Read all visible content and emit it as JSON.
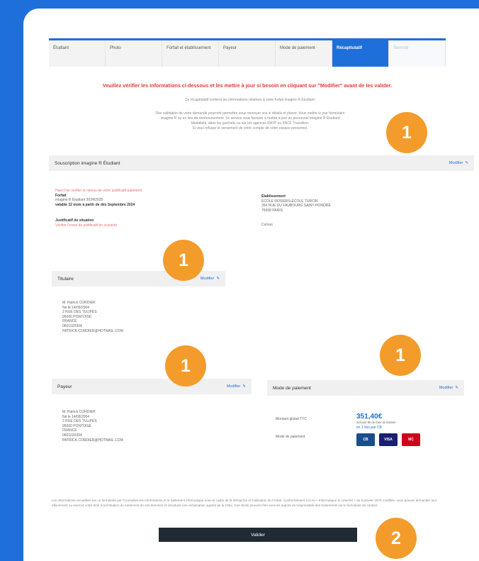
{
  "stepper": {
    "steps": [
      "Étudiant",
      "Photo",
      "Forfait et établissement",
      "Payeur",
      "Mode de paiement",
      "Récapitulatif",
      "Terminé"
    ]
  },
  "warning": "Veuillez vérifier les informations ci-dessous et les mettre à jour si besoin en cliquant sur \"Modifier\" avant de les valider.",
  "intro": {
    "line1": "Ce récapitulatif contient les informations relatives à votre forfait imagine R Étudiant.",
    "lines": [
      "Des validation de votre demande pourront permettre vous renvoyer vos si détails et placer. Vous mettre le jour formulaire",
      "imagine R ou en lieu de remboursement. Le service vous facturer à mettre à jour au personnel imagine R Étudiant",
      "Modalités, dans les guichets ou sur les agences RATP ou SNCF Transilien.",
      "Si vous refusez le versement de votre compte de votre espace personnel."
    ]
  },
  "subscription": {
    "title": "Souscription imagine R Étudiant",
    "modify": "Modifier",
    "note": "Hasn't be verifier le niveau de votre justificatif paiement",
    "forfait_label": "Forfait",
    "forfait_value": "imagine R Étudiant 2024/2025",
    "forfait_valid": "valable 12 mois à partir de dès Septembre 2024",
    "justif_label": "Justificatif de situation",
    "justif_value": "Vérifier l'envoi du justificatif de scolarité",
    "etab_label": "Établissement",
    "etab_lines": [
      "ECOLE ROSIERS-ECOLE TURCIN",
      "354 RUE DU FAUBOURG SAINT-HONORE",
      "75008 PARIS"
    ],
    "etab_extra": "Cursus"
  },
  "titulaire": {
    "title": "Titulaire",
    "modify": "Modifier",
    "lines": [
      "M. Patrick CORDIER",
      "Né le 14/09/2004",
      "2 RUE DES TULIPES",
      "95000 PONTOISE",
      "FRANCE",
      "0601020304",
      "PATRICK.CORDIER@HOTMAIL.COM"
    ]
  },
  "payeur": {
    "title": "Payeur",
    "modify": "Modifier",
    "lines": [
      "M. Patrick CORDIER",
      "Né le 14/09/2004",
      "2 RUE DES TULIPES",
      "95000 PONTOISE",
      "FRANCE",
      "0601020304",
      "PATRICK.CORDIER@HOTMAIL.COM"
    ]
  },
  "mode_paiement": {
    "title": "Mode de paiement",
    "modify": "Modifier",
    "montant_label": "Montant global TTC",
    "montant_value": "351,40€",
    "montant_note": "incluant 8€ de frais de dossier",
    "mode_label": "Mode de paiement",
    "mode_value": "en 1 fois par CB",
    "cards": [
      "CB",
      "VISA",
      "MC"
    ]
  },
  "legal": "Les informations recueillies sur ce formulaire par l'Consultez-les Informations et le traitement informatique sous le cadre de la démarche et l'utilisation du Forfait. Conformément à la loi « Informatique et Libertés » du 6 janvier 1978 modifiée, vous pouvez demander leur effacement ou exercer votre droit à la limitation du traitement de vos données et introduire une réclamation auprès de la CNIL. Ces droits peuvent être exercés auprès du responsable des traitements via le formulaire de contact.",
  "validate_label": "Valider",
  "badges": {
    "one": "1",
    "two": "2"
  },
  "colors": {
    "accent": "#1E6FD9",
    "badge": "#F39C2B",
    "warning": "#E53935"
  }
}
